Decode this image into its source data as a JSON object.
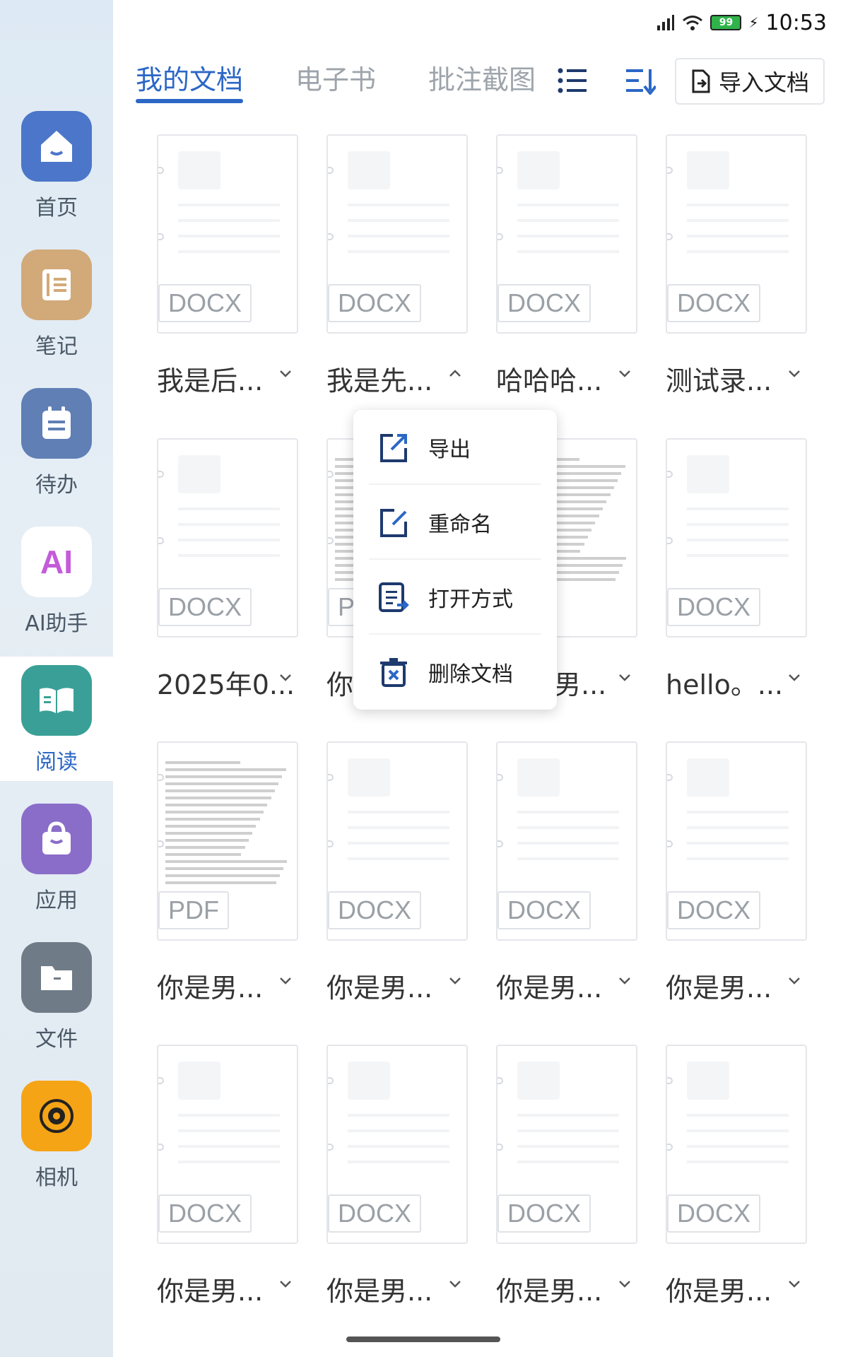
{
  "status_bar": {
    "time": "10:53",
    "battery": "99"
  },
  "sidebar": {
    "items": [
      {
        "label": "首页",
        "color": "#4c76c9",
        "icon": "home-icon"
      },
      {
        "label": "笔记",
        "color": "#d2a978",
        "icon": "notebook-icon"
      },
      {
        "label": "待办",
        "color": "#5f7fb5",
        "icon": "todo-icon"
      },
      {
        "label": "AI助手",
        "color": "#ffffff",
        "icon": "ai-icon",
        "glyph": "AI"
      },
      {
        "label": "阅读",
        "color": "#3aa097",
        "icon": "book-icon",
        "active": true
      },
      {
        "label": "应用",
        "color": "#8a6dc9",
        "icon": "bag-icon"
      },
      {
        "label": "文件",
        "color": "#6f7b86",
        "icon": "folder-icon"
      },
      {
        "label": "相机",
        "color": "#f5a416",
        "icon": "camera-icon"
      }
    ]
  },
  "toolbar": {
    "tabs": [
      "我的文档",
      "电子书",
      "批注截图"
    ],
    "active_tab": "我的文档",
    "import_label": "导入文档"
  },
  "documents": [
    {
      "name": "我是后...",
      "type": "DOCX"
    },
    {
      "name": "我是先...",
      "type": "DOCX",
      "expanded": true
    },
    {
      "name": "哈哈哈...",
      "type": "DOCX"
    },
    {
      "name": "测试录...",
      "type": "DOCX"
    },
    {
      "name": "2025年0...",
      "type": "DOCX"
    },
    {
      "name": "你",
      "type": "P"
    },
    {
      "name": "男...",
      "type": ""
    },
    {
      "name": "hello。...",
      "type": "DOCX"
    },
    {
      "name": "你是男...",
      "type": "PDF"
    },
    {
      "name": "你是男...",
      "type": "DOCX"
    },
    {
      "name": "你是男...",
      "type": "DOCX"
    },
    {
      "name": "你是男...",
      "type": "DOCX"
    },
    {
      "name": "你是男...",
      "type": "DOCX"
    },
    {
      "name": "你是男...",
      "type": "DOCX"
    },
    {
      "name": "你是男...",
      "type": "DOCX"
    },
    {
      "name": "你是男...",
      "type": "DOCX"
    }
  ],
  "context_menu": {
    "items": [
      {
        "label": "导出",
        "icon": "export-icon"
      },
      {
        "label": "重命名",
        "icon": "rename-icon"
      },
      {
        "label": "打开方式",
        "icon": "open-with-icon"
      },
      {
        "label": "删除文档",
        "icon": "delete-icon"
      }
    ]
  }
}
